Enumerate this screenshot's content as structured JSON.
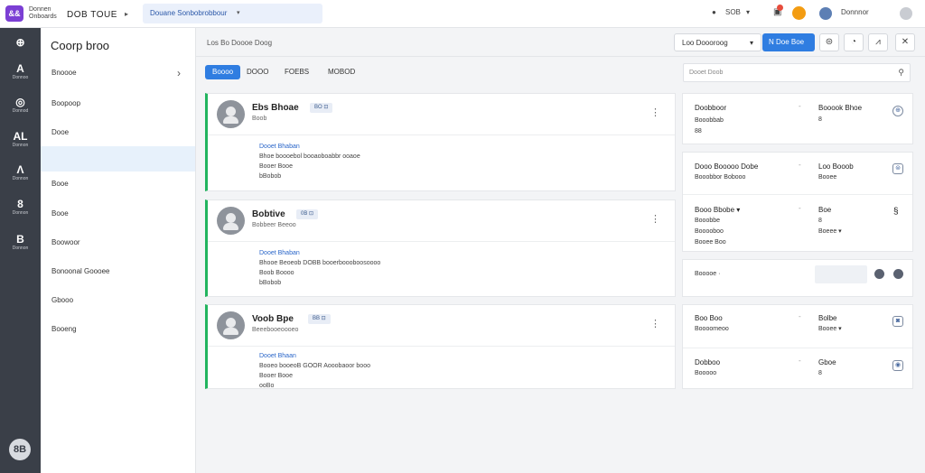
{
  "topbar": {
    "logo": "&&",
    "brand_line1": "Donnen",
    "brand_line2": "Onboards",
    "app_title": "DOB TOUE",
    "title_chevron": "▸",
    "project_select": "Douane Sonbobrobbour",
    "project_chevron": "▾",
    "status_text": "SOB",
    "status_chevron": "▾",
    "user_label": "Donnnor"
  },
  "rail": {
    "items": [
      {
        "icon": "⊕",
        "label": ""
      },
      {
        "icon": "A",
        "label": "Donnoo"
      },
      {
        "icon": "◎",
        "label": "Donnod"
      },
      {
        "icon": "AL",
        "label": "Donnon"
      },
      {
        "icon": "Λ",
        "label": "Donnon"
      },
      {
        "icon": "8",
        "label": "Donnon"
      },
      {
        "icon": "B",
        "label": "Donnon"
      }
    ],
    "user_initials": "8B"
  },
  "sidebar": {
    "title": "Coorp broo",
    "items": [
      {
        "label": "Bnoooe",
        "chevron": "›"
      },
      {
        "label": "Boopoop"
      },
      {
        "label": "Dooe"
      },
      {
        "label": ""
      },
      {
        "label": "Booe"
      },
      {
        "label": "Booe"
      },
      {
        "label": "Boowoor"
      },
      {
        "label": "Bonoonal Goooee"
      },
      {
        "label": "Gbooo"
      },
      {
        "label": "Booeng"
      }
    ]
  },
  "main": {
    "breadcrumb": "Los Bo  Doooe Doog",
    "dropdown_label": "Loo Doooroog",
    "dropdown_chevron": "▾",
    "primary_button": "N Doe Boe",
    "icon_buttons": [
      "⊜",
      "◔",
      "⩘",
      "✕"
    ],
    "filters": [
      "Boooo",
      "DOOO",
      "FOEBS",
      "MOBOD"
    ],
    "search_placeholder": "Dooet Doob",
    "search_icon": "⚲"
  },
  "cards": [
    {
      "name": "Ebs Bhoae",
      "tag": "BO ⊡",
      "subtitle": "Boob",
      "menu": "⋮",
      "body": [
        "Dooet Bhaban",
        "Bhoe boooebol booaoboabbr ooaoe",
        "Booer Booe",
        "bBobob"
      ]
    },
    {
      "name": "Bobtive",
      "tag": "0B ⊡",
      "subtitle": "Bobbeer Beeoo",
      "menu": "⋮",
      "body": [
        "Dooet Bhaban",
        "Bhooe Beoeob DOBB booerboooboosoooo",
        "Boob Boooo",
        "bBobob"
      ]
    },
    {
      "name": "Voob Bpe",
      "tag": "BB ⊡",
      "subtitle": "Beeebooeoooeo",
      "menu": "⋮",
      "body": [
        "Dooet Bhaan",
        "Booeo booeoB GOOR Aooobaoor booo",
        "Booer Booe",
        "ooBo"
      ]
    }
  ],
  "panels": [
    {
      "rows": [
        [
          "Doobboor",
          "Booobbab",
          "88"
        ],
        [
          "Booook Bhoe",
          "8"
        ]
      ],
      "icon": "⊕"
    },
    {
      "rows": [
        [
          "Dooo Booooo Dobe",
          "Booobbor Bobooo"
        ],
        [
          "Loo Booob",
          "Booee"
        ]
      ],
      "icon": "⊜"
    },
    {
      "rows": [
        [
          "Booo Bbobe ▾",
          "Booobbe",
          "Booooboo",
          "Booee Boo"
        ],
        [
          "Boe",
          "8",
          "Boeee ▾"
        ]
      ],
      "icon": "§"
    },
    {
      "rows": [
        [
          "Booooe ·"
        ]
      ],
      "icon": "◍"
    },
    {
      "rows": [
        [
          "Boo Boo",
          "Boooomeoo"
        ],
        [
          "Bolbe",
          "Booee ▾"
        ]
      ],
      "icon": "◙"
    },
    {
      "rows": [
        [
          "Dobboo",
          "Booooo"
        ],
        [
          "Gboe",
          "8"
        ]
      ],
      "icon": "◉"
    }
  ],
  "colors": {
    "accent": "#2f7de1",
    "brand": "#7b3fd4",
    "status_green": "#22b45e",
    "rail": "#3a3f48",
    "badge_orange": "#f39c12",
    "badge_red": "#e74c3c"
  }
}
